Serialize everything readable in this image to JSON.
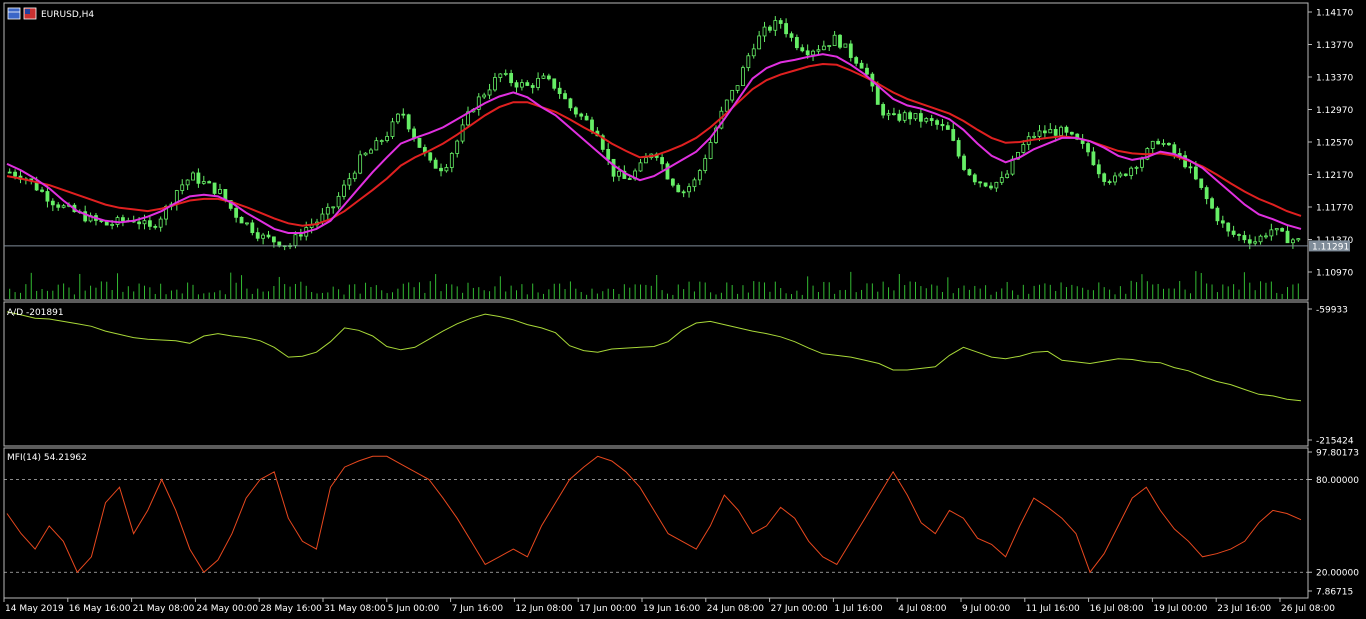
{
  "symbol_label": "EURUSD,H4",
  "colors": {
    "background": "#000000",
    "frame": "#b8b8b8",
    "candles": "#66ee66",
    "volume": "#33bb33",
    "ma_fast": "#e030e0",
    "ma_slow": "#e02020",
    "ad_line": "#a8d838",
    "mfi_line": "#e8481e",
    "price_line": "#7f8c99",
    "price_badge": "#7f8c99"
  },
  "time_labels": [
    "14 May 2019",
    "16 May 16:00",
    "21 May 08:00",
    "24 May 00:00",
    "28 May 16:00",
    "31 May 08:00",
    "5 Jun 00:00",
    "7 Jun 16:00",
    "12 Jun 08:00",
    "17 Jun 00:00",
    "19 Jun 16:00",
    "24 Jun 08:00",
    "27 Jun 00:00",
    "1 Jul 16:00",
    "4 Jul 08:00",
    "9 Jul 00:00",
    "11 Jul 16:00",
    "16 Jul 08:00",
    "19 Jul 00:00",
    "23 Jul 16:00",
    "26 Jul 08:00"
  ],
  "chart_data": [
    {
      "type": "candlestick",
      "title": "EURUSD,H4",
      "ylim": [
        1.108,
        1.1432
      ],
      "y_ticks": [
        "1.14170",
        "1.13770",
        "1.13370",
        "1.12970",
        "1.12570",
        "1.12170",
        "1.11770",
        "1.11370",
        "1.10970"
      ],
      "current_price": "1.11291",
      "price_path": [
        1.122,
        1.1215,
        1.12,
        1.1185,
        1.1175,
        1.1168,
        1.116,
        1.1155,
        1.116,
        1.1162,
        1.115,
        1.117,
        1.12,
        1.1215,
        1.1205,
        1.1195,
        1.117,
        1.1155,
        1.114,
        1.1135,
        1.113,
        1.115,
        1.116,
        1.1175,
        1.1205,
        1.1235,
        1.125,
        1.1268,
        1.1295,
        1.126,
        1.123,
        1.1225,
        1.126,
        1.13,
        1.132,
        1.134,
        1.133,
        1.1325,
        1.1335,
        1.1325,
        1.13,
        1.1285,
        1.127,
        1.122,
        1.121,
        1.1225,
        1.125,
        1.1215,
        1.1195,
        1.121,
        1.1255,
        1.13,
        1.133,
        1.1375,
        1.1395,
        1.1405,
        1.138,
        1.137,
        1.1375,
        1.1385,
        1.1365,
        1.135,
        1.13,
        1.1285,
        1.129,
        1.1285,
        1.128,
        1.127,
        1.123,
        1.121,
        1.1205,
        1.121,
        1.1245,
        1.1265,
        1.127,
        1.127,
        1.126,
        1.1245,
        1.1215,
        1.121,
        1.1225,
        1.124,
        1.126,
        1.1245,
        1.123,
        1.12,
        1.117,
        1.1145,
        1.114,
        1.1135,
        1.115,
        1.114,
        1.1135
      ],
      "ma_fast": [
        1.123,
        1.1222,
        1.1212,
        1.12,
        1.1185,
        1.1172,
        1.1165,
        1.116,
        1.1158,
        1.116,
        1.1165,
        1.1172,
        1.1182,
        1.119,
        1.1192,
        1.119,
        1.1182,
        1.117,
        1.116,
        1.115,
        1.1145,
        1.1145,
        1.115,
        1.116,
        1.118,
        1.12,
        1.122,
        1.1238,
        1.1255,
        1.1262,
        1.1268,
        1.1275,
        1.1285,
        1.1295,
        1.1305,
        1.1313,
        1.1318,
        1.1312,
        1.13,
        1.129,
        1.1275,
        1.126,
        1.1245,
        1.123,
        1.1218,
        1.121,
        1.1215,
        1.1225,
        1.1235,
        1.1245,
        1.1262,
        1.1285,
        1.131,
        1.1335,
        1.1348,
        1.1355,
        1.1358,
        1.1362,
        1.1365,
        1.1362,
        1.1352,
        1.134,
        1.1325,
        1.131,
        1.1302,
        1.1298,
        1.1292,
        1.1285,
        1.1272,
        1.1255,
        1.124,
        1.1232,
        1.1238,
        1.1248,
        1.1255,
        1.1262,
        1.1262,
        1.1258,
        1.125,
        1.124,
        1.1235,
        1.1238,
        1.1245,
        1.1242,
        1.1235,
        1.1225,
        1.121,
        1.1195,
        1.118,
        1.1168,
        1.1162,
        1.1155,
        1.115
      ],
      "ma_slow": [
        1.1215,
        1.1212,
        1.1208,
        1.1204,
        1.1198,
        1.1192,
        1.1186,
        1.118,
        1.1176,
        1.1174,
        1.1172,
        1.1175,
        1.118,
        1.1185,
        1.1187,
        1.1187,
        1.1183,
        1.1177,
        1.117,
        1.1163,
        1.1157,
        1.1154,
        1.1156,
        1.1162,
        1.1172,
        1.1185,
        1.1198,
        1.1212,
        1.1228,
        1.1238,
        1.1246,
        1.1255,
        1.1266,
        1.1278,
        1.129,
        1.13,
        1.1306,
        1.1306,
        1.13,
        1.1294,
        1.1285,
        1.1275,
        1.1266,
        1.1255,
        1.1246,
        1.1238,
        1.124,
        1.1246,
        1.1253,
        1.1262,
        1.1275,
        1.129,
        1.1306,
        1.1322,
        1.1333,
        1.134,
        1.1345,
        1.135,
        1.1353,
        1.1352,
        1.1345,
        1.1337,
        1.1328,
        1.1318,
        1.131,
        1.1304,
        1.1298,
        1.1292,
        1.1283,
        1.1272,
        1.1262,
        1.1256,
        1.1257,
        1.126,
        1.1262,
        1.1264,
        1.1262,
        1.1258,
        1.1252,
        1.1246,
        1.1243,
        1.1242,
        1.1243,
        1.124,
        1.1234,
        1.1227,
        1.1217,
        1.1206,
        1.1196,
        1.1187,
        1.118,
        1.1172,
        1.1166
      ],
      "volume_note": "volume histogram at bottom of price pane"
    },
    {
      "type": "line",
      "title": "A/D -201891",
      "y_ticks": [
        "-59933",
        "-215424"
      ],
      "ylim": [
        -215424,
        -59933
      ],
      "values": [
        -62000,
        -66000,
        -70000,
        -71000,
        -74000,
        -77000,
        -80000,
        -86000,
        -90000,
        -94000,
        -96000,
        -97000,
        -98000,
        -101000,
        -92000,
        -89000,
        -92000,
        -94000,
        -98000,
        -106000,
        -118000,
        -117000,
        -112000,
        -99000,
        -82000,
        -85000,
        -92000,
        -105000,
        -109000,
        -106000,
        -96000,
        -86000,
        -77000,
        -70000,
        -65000,
        -68000,
        -72000,
        -78000,
        -82000,
        -88000,
        -104000,
        -110000,
        -112000,
        -108000,
        -107000,
        -106000,
        -105000,
        -99000,
        -85000,
        -76000,
        -74000,
        -78000,
        -82000,
        -86000,
        -89000,
        -93000,
        -99000,
        -107000,
        -114000,
        -116000,
        -118000,
        -122000,
        -126000,
        -134000,
        -134000,
        -132000,
        -130000,
        -116000,
        -106000,
        -112000,
        -118000,
        -120000,
        -117000,
        -112000,
        -111000,
        -122000,
        -124000,
        -126000,
        -123000,
        -120000,
        -121000,
        -124000,
        -125000,
        -131000,
        -135000,
        -142000,
        -148000,
        -152000,
        -158000,
        -164000,
        -166000,
        -170000,
        -172000
      ]
    },
    {
      "type": "line",
      "title": "MFI(14) 54.21962",
      "y_ticks": [
        "97.80173",
        "80.00000",
        "20.00000",
        "7.86715"
      ],
      "ylim": [
        7.86715,
        97.80173
      ],
      "levels": [
        80,
        20
      ],
      "values": [
        58,
        45,
        35,
        50,
        40,
        20,
        30,
        65,
        75,
        45,
        60,
        80,
        60,
        35,
        20,
        28,
        45,
        68,
        80,
        85,
        55,
        40,
        35,
        75,
        88,
        92,
        95,
        95,
        90,
        85,
        80,
        68,
        55,
        40,
        25,
        30,
        35,
        30,
        50,
        65,
        80,
        88,
        95,
        92,
        85,
        75,
        60,
        45,
        40,
        35,
        50,
        70,
        60,
        45,
        50,
        62,
        55,
        40,
        30,
        25,
        40,
        55,
        70,
        85,
        70,
        52,
        45,
        60,
        55,
        42,
        38,
        30,
        50,
        68,
        62,
        55,
        45,
        20,
        32,
        50,
        68,
        75,
        60,
        48,
        40,
        30,
        32,
        35,
        40,
        52,
        60,
        58,
        54
      ]
    }
  ]
}
